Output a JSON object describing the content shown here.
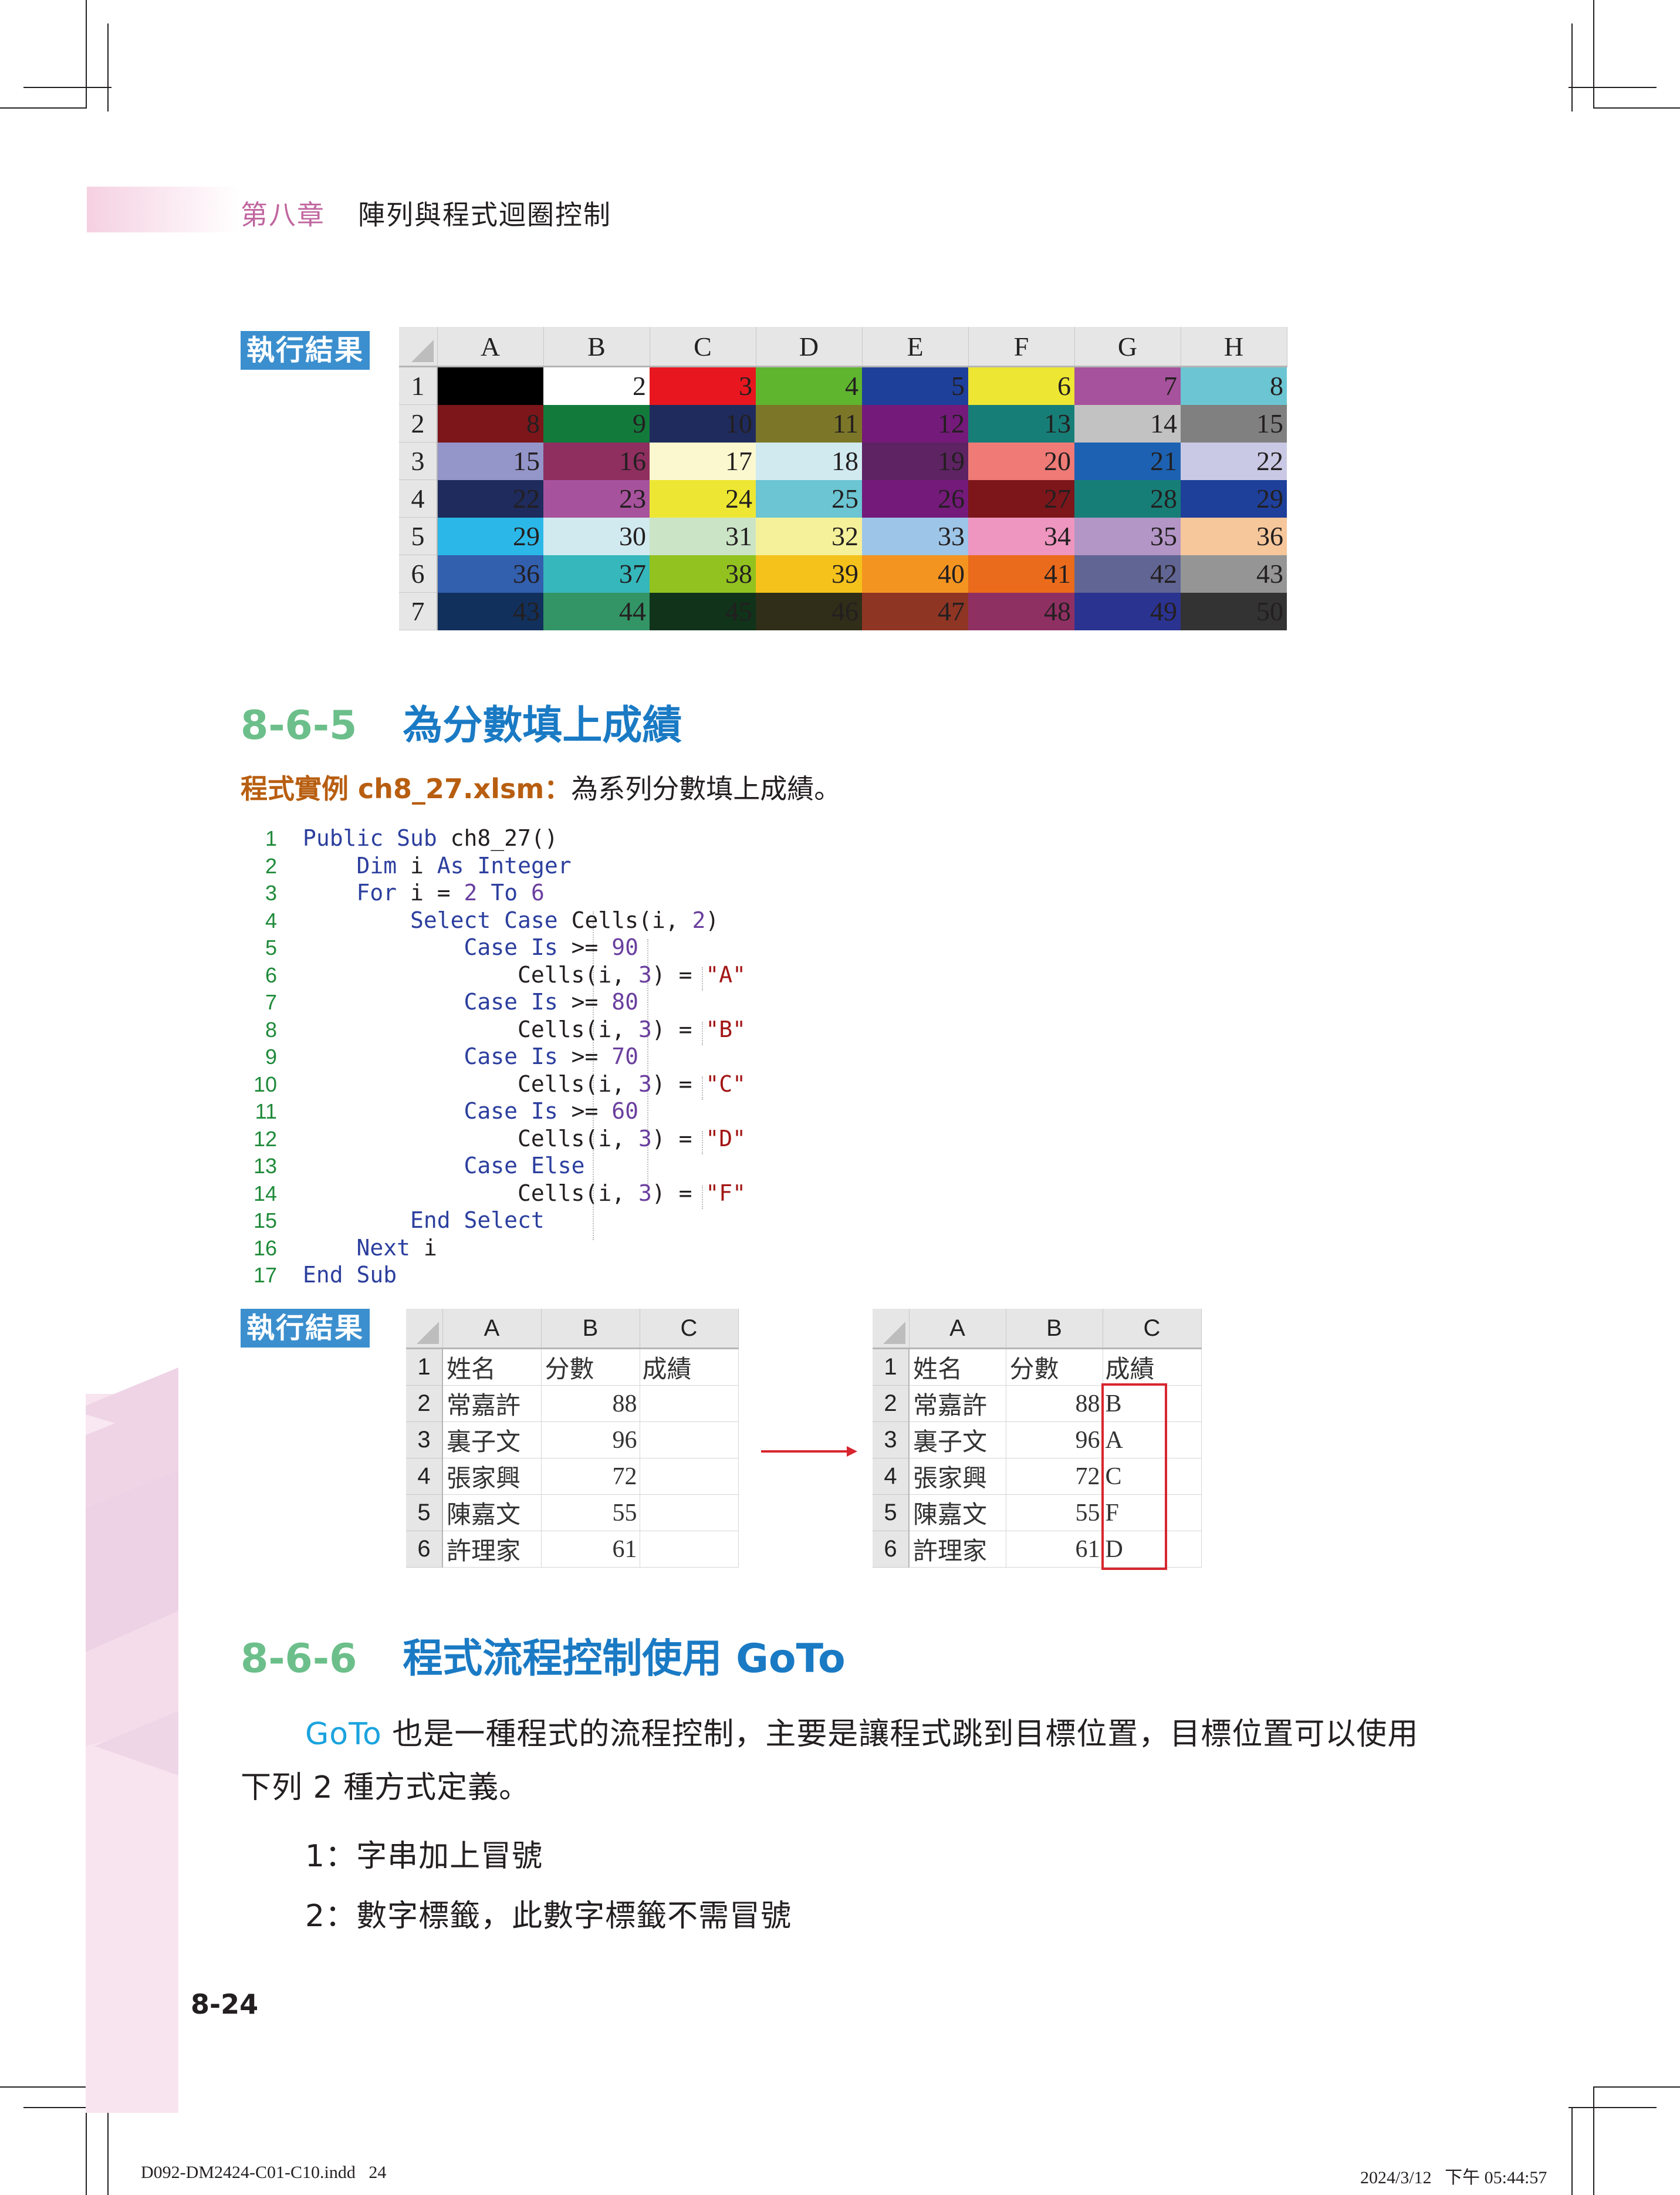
{
  "header": {
    "chapter_number": "第八章",
    "chapter_title": "陣列與程式迴圈控制"
  },
  "result_label": "執行結果",
  "color_grid": {
    "columns": [
      "A",
      "B",
      "C",
      "D",
      "E",
      "F",
      "G",
      "H"
    ],
    "rows": [
      {
        "row": "1",
        "cells": [
          {
            "value": "",
            "color": "#000000"
          },
          {
            "value": "2",
            "color": "#ffffff"
          },
          {
            "value": "3",
            "color": "#e8171f"
          },
          {
            "value": "4",
            "color": "#5fb52e"
          },
          {
            "value": "5",
            "color": "#1e409a"
          },
          {
            "value": "6",
            "color": "#ede733"
          },
          {
            "value": "7",
            "color": "#a7529c"
          },
          {
            "value": "8",
            "color": "#6bc5d2"
          }
        ]
      },
      {
        "row": "2",
        "cells": [
          {
            "value": "8",
            "color": "#7c161a"
          },
          {
            "value": "9",
            "color": "#127b3c"
          },
          {
            "value": "10",
            "color": "#1f2b5c"
          },
          {
            "value": "11",
            "color": "#7c7728"
          },
          {
            "value": "12",
            "color": "#741a7a"
          },
          {
            "value": "13",
            "color": "#177e77"
          },
          {
            "value": "14",
            "color": "#c2c2c2"
          },
          {
            "value": "15",
            "color": "#808080"
          }
        ]
      },
      {
        "row": "3",
        "cells": [
          {
            "value": "15",
            "color": "#9495c9"
          },
          {
            "value": "16",
            "color": "#8e2f5f"
          },
          {
            "value": "17",
            "color": "#fbf8d0"
          },
          {
            "value": "18",
            "color": "#d1eaf0"
          },
          {
            "value": "19",
            "color": "#5d2363"
          },
          {
            "value": "20",
            "color": "#ef7a76"
          },
          {
            "value": "21",
            "color": "#1d62b2"
          },
          {
            "value": "22",
            "color": "#c9c9e5"
          }
        ]
      },
      {
        "row": "4",
        "cells": [
          {
            "value": "22",
            "color": "#1e2b5c"
          },
          {
            "value": "23",
            "color": "#a7529c"
          },
          {
            "value": "24",
            "color": "#ede733"
          },
          {
            "value": "25",
            "color": "#6bc5d2"
          },
          {
            "value": "26",
            "color": "#741a7a"
          },
          {
            "value": "27",
            "color": "#7c161a"
          },
          {
            "value": "28",
            "color": "#177e77"
          },
          {
            "value": "29",
            "color": "#1e409a"
          }
        ]
      },
      {
        "row": "5",
        "cells": [
          {
            "value": "29",
            "color": "#2bb8e8"
          },
          {
            "value": "30",
            "color": "#d1eaf0"
          },
          {
            "value": "31",
            "color": "#cbe4c6"
          },
          {
            "value": "32",
            "color": "#f5f19a"
          },
          {
            "value": "33",
            "color": "#9dc5e8"
          },
          {
            "value": "34",
            "color": "#ee96bf"
          },
          {
            "value": "35",
            "color": "#b396c6"
          },
          {
            "value": "36",
            "color": "#f6c79b"
          }
        ]
      },
      {
        "row": "6",
        "cells": [
          {
            "value": "36",
            "color": "#325fae"
          },
          {
            "value": "37",
            "color": "#35b7bb"
          },
          {
            "value": "38",
            "color": "#92c220"
          },
          {
            "value": "39",
            "color": "#f5c21c"
          },
          {
            "value": "40",
            "color": "#f39420"
          },
          {
            "value": "41",
            "color": "#ea6b1b"
          },
          {
            "value": "42",
            "color": "#616593"
          },
          {
            "value": "43",
            "color": "#959595"
          }
        ]
      },
      {
        "row": "7",
        "cells": [
          {
            "value": "43",
            "color": "#11305c"
          },
          {
            "value": "44",
            "color": "#339465"
          },
          {
            "value": "45",
            "color": "#10331a"
          },
          {
            "value": "46",
            "color": "#302e18"
          },
          {
            "value": "47",
            "color": "#8f3524"
          },
          {
            "value": "48",
            "color": "#8f3063"
          },
          {
            "value": "49",
            "color": "#2b3390"
          },
          {
            "value": "50",
            "color": "#333333"
          }
        ]
      }
    ]
  },
  "section_865": {
    "number": "8-6-5",
    "title": "為分數填上成績",
    "example_label": "程式實例 ch8_27.xlsm：",
    "example_desc": "為系列分數填上成績。"
  },
  "code": {
    "lines": [
      {
        "n": "1",
        "indent": 0,
        "tokens": [
          [
            "kw",
            "Public Sub "
          ],
          [
            "id",
            "ch8_27()"
          ]
        ]
      },
      {
        "n": "2",
        "indent": 1,
        "tokens": [
          [
            "kw",
            "Dim "
          ],
          [
            "id",
            "i "
          ],
          [
            "kw",
            "As Integer"
          ]
        ]
      },
      {
        "n": "3",
        "indent": 1,
        "tokens": [
          [
            "kw",
            "For "
          ],
          [
            "id",
            "i = "
          ],
          [
            "num",
            "2 "
          ],
          [
            "kw",
            "To "
          ],
          [
            "num",
            "6"
          ]
        ]
      },
      {
        "n": "4",
        "indent": 2,
        "tokens": [
          [
            "kw",
            "Select Case "
          ],
          [
            "id",
            "Cells(i, "
          ],
          [
            "num",
            "2"
          ],
          [
            "id",
            ")"
          ]
        ]
      },
      {
        "n": "5",
        "indent": 3,
        "tokens": [
          [
            "kw",
            "Case Is "
          ],
          [
            "id",
            ">= "
          ],
          [
            "num",
            "90"
          ]
        ]
      },
      {
        "n": "6",
        "indent": 4,
        "tokens": [
          [
            "id",
            "Cells(i, "
          ],
          [
            "num",
            "3"
          ],
          [
            "id",
            ") = "
          ],
          [
            "str",
            "\"A\""
          ]
        ]
      },
      {
        "n": "7",
        "indent": 3,
        "tokens": [
          [
            "kw",
            "Case Is "
          ],
          [
            "id",
            ">= "
          ],
          [
            "num",
            "80"
          ]
        ]
      },
      {
        "n": "8",
        "indent": 4,
        "tokens": [
          [
            "id",
            "Cells(i, "
          ],
          [
            "num",
            "3"
          ],
          [
            "id",
            ") = "
          ],
          [
            "str",
            "\"B\""
          ]
        ]
      },
      {
        "n": "9",
        "indent": 3,
        "tokens": [
          [
            "kw",
            "Case Is "
          ],
          [
            "id",
            ">= "
          ],
          [
            "num",
            "70"
          ]
        ]
      },
      {
        "n": "10",
        "indent": 4,
        "tokens": [
          [
            "id",
            "Cells(i, "
          ],
          [
            "num",
            "3"
          ],
          [
            "id",
            ") = "
          ],
          [
            "str",
            "\"C\""
          ]
        ]
      },
      {
        "n": "11",
        "indent": 3,
        "tokens": [
          [
            "kw",
            "Case Is "
          ],
          [
            "id",
            ">= "
          ],
          [
            "num",
            "60"
          ]
        ]
      },
      {
        "n": "12",
        "indent": 4,
        "tokens": [
          [
            "id",
            "Cells(i, "
          ],
          [
            "num",
            "3"
          ],
          [
            "id",
            ") = "
          ],
          [
            "str",
            "\"D\""
          ]
        ]
      },
      {
        "n": "13",
        "indent": 3,
        "tokens": [
          [
            "kw",
            "Case Else"
          ]
        ]
      },
      {
        "n": "14",
        "indent": 4,
        "tokens": [
          [
            "id",
            "Cells(i, "
          ],
          [
            "num",
            "3"
          ],
          [
            "id",
            ") = "
          ],
          [
            "str",
            "\"F\""
          ]
        ]
      },
      {
        "n": "15",
        "indent": 2,
        "tokens": [
          [
            "kw",
            "End Select"
          ]
        ]
      },
      {
        "n": "16",
        "indent": 1,
        "tokens": [
          [
            "kw",
            "Next "
          ],
          [
            "id",
            "i"
          ]
        ]
      },
      {
        "n": "17",
        "indent": 0,
        "tokens": [
          [
            "kw",
            "End Sub"
          ]
        ]
      }
    ]
  },
  "grade_tables": {
    "columns": [
      "A",
      "B",
      "C"
    ],
    "before": {
      "rows": [
        {
          "row": "1",
          "cells": [
            "姓名",
            "分數",
            "成績"
          ]
        },
        {
          "row": "2",
          "cells": [
            "常嘉許",
            "88",
            ""
          ]
        },
        {
          "row": "3",
          "cells": [
            "裏子文",
            "96",
            ""
          ]
        },
        {
          "row": "4",
          "cells": [
            "張家興",
            "72",
            ""
          ]
        },
        {
          "row": "5",
          "cells": [
            "陳嘉文",
            "55",
            ""
          ]
        },
        {
          "row": "6",
          "cells": [
            "許理家",
            "61",
            ""
          ]
        }
      ]
    },
    "after": {
      "rows": [
        {
          "row": "1",
          "cells": [
            "姓名",
            "分數",
            "成績"
          ]
        },
        {
          "row": "2",
          "cells": [
            "常嘉許",
            "88",
            "B"
          ]
        },
        {
          "row": "3",
          "cells": [
            "裏子文",
            "96",
            "A"
          ]
        },
        {
          "row": "4",
          "cells": [
            "張家興",
            "72",
            "C"
          ]
        },
        {
          "row": "5",
          "cells": [
            "陳嘉文",
            "55",
            "F"
          ]
        },
        {
          "row": "6",
          "cells": [
            "許理家",
            "61",
            "D"
          ]
        }
      ]
    },
    "highlight_color": "#d7262e",
    "arrow_color": "#d7262e"
  },
  "section_866": {
    "number": "8-6-6",
    "title": "程式流程控制使用 GoTo",
    "para_keyword": "GoTo",
    "para_line1_rest": " 也是一種程式的流程控制，主要是讓程式跳到目標位置，目標位置可以使用",
    "para_line2": "下列 2 種方式定義。",
    "items": [
      "1：字串加上冒號",
      "2：數字標籤，此數字標籤不需冒號"
    ]
  },
  "page_number": "8-24",
  "footer": {
    "left": "D092-DM2424-C01-C10.indd   24",
    "right": "2024/3/12   下午 05:44:57"
  }
}
